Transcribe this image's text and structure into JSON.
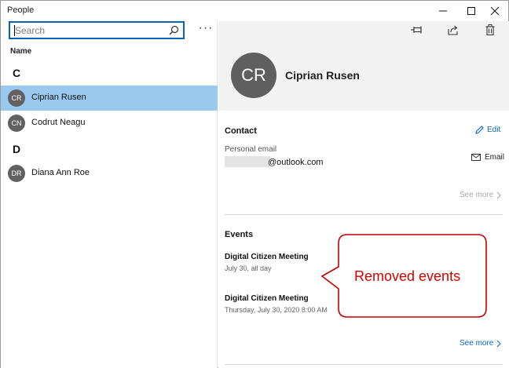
{
  "window": {
    "title": "People"
  },
  "search": {
    "placeholder": "Search"
  },
  "list": {
    "column_header": "Name",
    "groups": [
      {
        "letter": "C",
        "contacts": [
          {
            "initials": "CR",
            "name": "Ciprian Rusen",
            "selected": true
          },
          {
            "initials": "CN",
            "name": "Codrut Neagu",
            "selected": false
          }
        ]
      },
      {
        "letter": "D",
        "contacts": [
          {
            "initials": "DR",
            "name": "Diana Ann Roe",
            "selected": false
          }
        ]
      }
    ]
  },
  "profile": {
    "initials": "CR",
    "name": "Ciprian Rusen"
  },
  "contact_section": {
    "title": "Contact",
    "edit_label": "Edit",
    "email_label": "Personal email",
    "email_value": "@outlook.com",
    "email_action": "Email",
    "see_more": "See more"
  },
  "events_section": {
    "title": "Events",
    "items": [
      {
        "title": "Digital Citizen Meeting",
        "subtitle": "July 30, all day"
      },
      {
        "title": "Digital Citizen Meeting",
        "subtitle": "Thursday, July 30, 2020 8:00 AM"
      }
    ],
    "see_more": "See more"
  },
  "annotation": {
    "text": "Removed events"
  },
  "colors": {
    "accent": "#0a64b4",
    "selected_row": "#99c9ef",
    "callout_red": "#d40000"
  }
}
